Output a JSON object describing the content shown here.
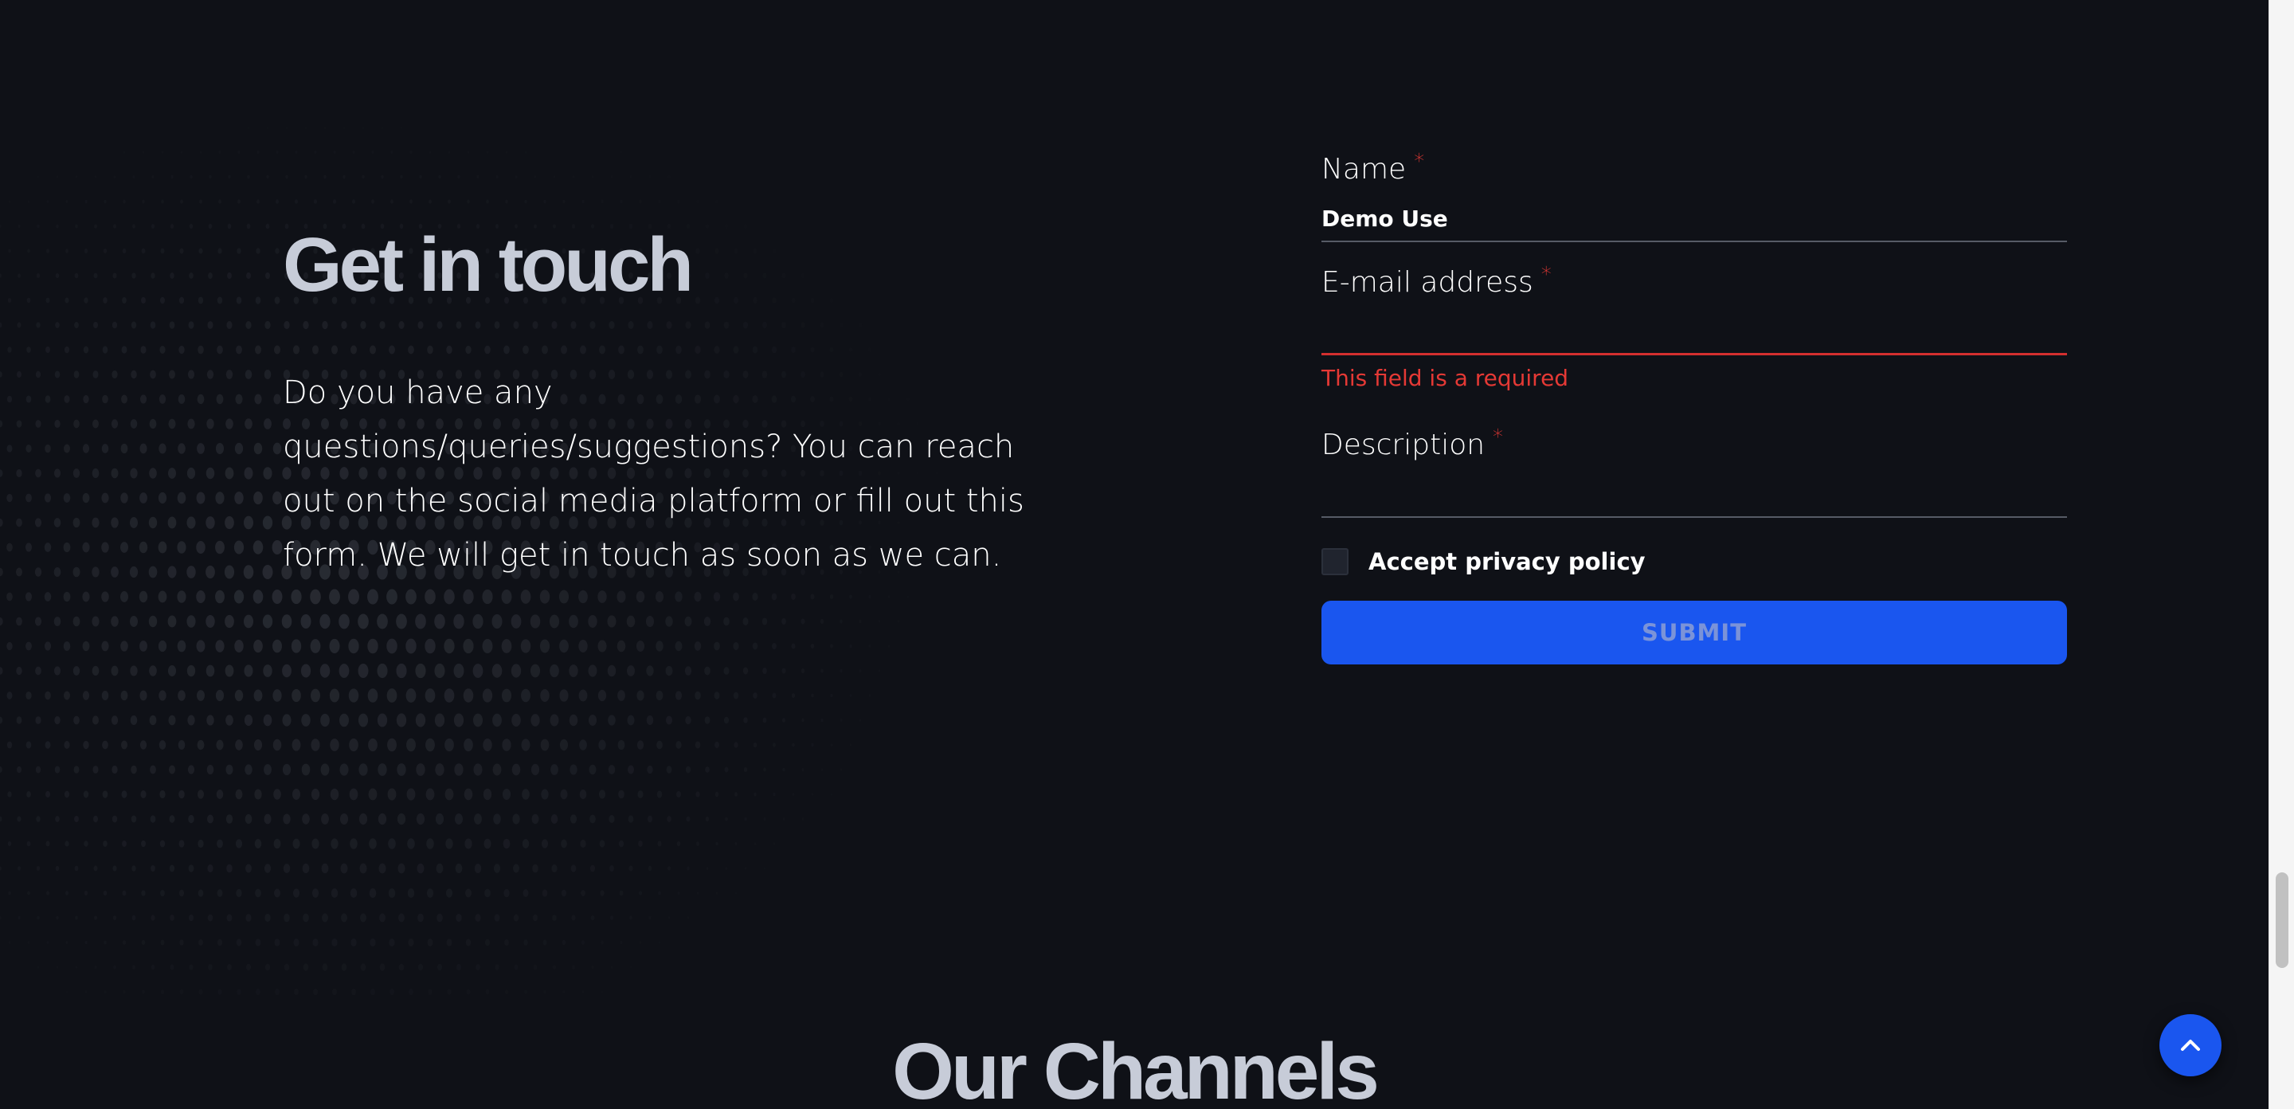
{
  "contact": {
    "heading": "Get in touch",
    "intro": "Do you have any questions/queries/suggestions? You can reach out on the social media platform or fill out this form. We will get in touch as soon as we can."
  },
  "form": {
    "name": {
      "label": "Name",
      "required_mark": "*",
      "value": "Demo Use"
    },
    "email": {
      "label": "E-mail address",
      "required_mark": "*",
      "value": "",
      "error": "This field is a required"
    },
    "description": {
      "label": "Description",
      "required_mark": "*",
      "value": ""
    },
    "privacy": {
      "label": "Accept privacy policy",
      "checked": false
    },
    "submit_label": "SUBMIT"
  },
  "channels": {
    "heading": "Our Channels"
  },
  "icons": {
    "scroll_top": "chevron-up-icon",
    "checkbox": "checkbox-unchecked-icon"
  },
  "colors": {
    "background": "#0f1117",
    "heading": "#c7ccd8",
    "accent": "#1a56ef",
    "error": "#e53935",
    "input_border": "#565b66"
  }
}
